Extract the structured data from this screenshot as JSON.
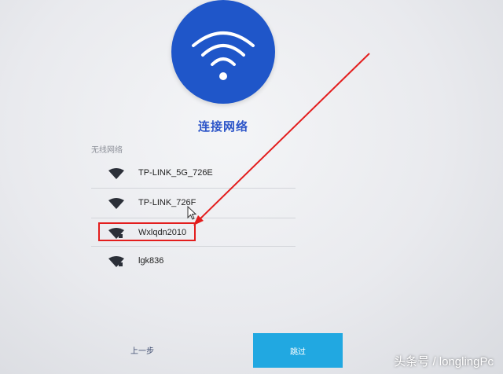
{
  "header": {
    "title": "连接网络"
  },
  "networks": {
    "section_label": "无线网络",
    "items": [
      {
        "ssid": "TP-LINK_5G_726E",
        "secured": false
      },
      {
        "ssid": "TP-LINK_726F",
        "secured": false
      },
      {
        "ssid": "Wxlqdn2010",
        "secured": true,
        "highlighted": true
      },
      {
        "ssid": "lgk836",
        "secured": true
      }
    ]
  },
  "footer": {
    "back_label": "上一步",
    "skip_label": "跳过"
  },
  "watermark": {
    "text": "头条号 / longlingPc"
  },
  "colors": {
    "accent": "#1f56c9",
    "title": "#2d55c8",
    "skip_button": "#21a8e1",
    "annotation": "#e31d1d"
  },
  "icons": {
    "hero": "wifi-icon",
    "network": "wifi-signal-icon",
    "lock": "lock-icon"
  }
}
